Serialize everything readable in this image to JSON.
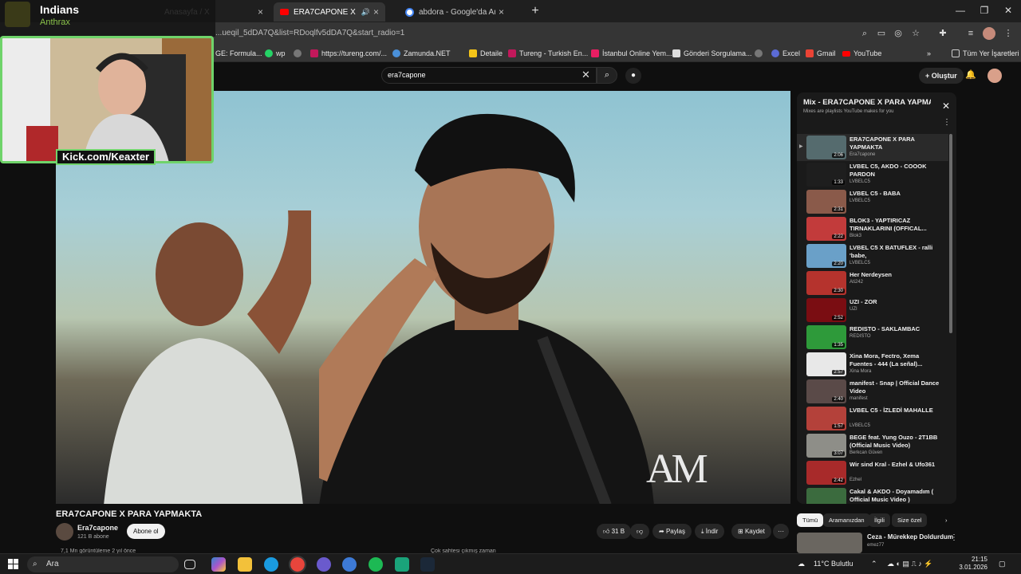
{
  "tabs": [
    {
      "title": "Anasayfa / X",
      "icon": "x-icon",
      "close": "×"
    },
    {
      "title": "ERA7CAPONE X PARA YAPM",
      "icon": "youtube-icon",
      "close": "×",
      "audio": "🔊"
    },
    {
      "title": "abdora - Google'da Ara",
      "icon": "google-icon",
      "close": "×"
    }
  ],
  "new_tab": "+",
  "window_controls": [
    "—",
    "❐",
    "✕"
  ],
  "address": {
    "url": "...ueqil_5dDA7Q&list=RDoqlfv5dDA7Q&start_radio=1"
  },
  "bookmarks": [
    {
      "label": "GE: Formula..."
    },
    {
      "label": "wp"
    },
    {
      "label": "https://tureng.com/..."
    },
    {
      "label": "Zamunda.NET"
    },
    {
      "label": "Detaile"
    },
    {
      "label": "Tureng - Turkish En..."
    },
    {
      "label": "İstanbul Online Yem..."
    },
    {
      "label": "Gönderi Sorgulama..."
    },
    {
      "label": "Excel"
    },
    {
      "label": "Gmail"
    },
    {
      "label": "YouTube"
    },
    {
      "label": "»"
    },
    {
      "label": "Tüm Yer İşaretleri"
    }
  ],
  "stream": {
    "channel": "Indians",
    "sub": "Anthrax",
    "kick_label": "Kick.com/Keaxter"
  },
  "youtube": {
    "search_value": "era7capone",
    "clear": "✕",
    "create_label": "+ Oluştur",
    "video_title": "ERA7CAPONE X PARA YAPMAKTA",
    "channel_name": "Era7capone",
    "subscribers": "121 B abone",
    "subscribe_label": "Abone ol",
    "likes": "31 B",
    "share_label": "Paylaş",
    "download_label": "İndir",
    "save_label": "Kaydet",
    "more": "···",
    "desc_left": "7,1 Mn görüntüleme  2 yıl önce",
    "desc_right": "Çok sahtesi çıkmış zaman"
  },
  "playlist": {
    "title": "Mix - ERA7CAPONE X PARA YAPMAKTA",
    "subtitle": "Mixes are playlists YouTube makes for you",
    "items": [
      {
        "title": "ERA7CAPONE X PARA YAPMAKTA",
        "channel": "Era7capone",
        "duration": "2:06",
        "color": "#556b6e"
      },
      {
        "title": "LVBEL C5, AKDO - COOOK PARDON",
        "channel": "LVBELC5",
        "duration": "1:33",
        "color": "#1e1e1e"
      },
      {
        "title": "LVBEL C5 - BABA",
        "channel": "LVBELC5",
        "duration": "2:31",
        "color": "#8a5a4a"
      },
      {
        "title": "BLOK3 - YAPTIRICAZ TIRNAKLARINI (OFFICAL...",
        "channel": "Blok3",
        "duration": "2:22",
        "color": "#c23b3b"
      },
      {
        "title": "LVBEL C5 X BATUFLEX - ralli 'babe,",
        "channel": "LVBELC5",
        "duration": "2:20",
        "color": "#6aa0c8"
      },
      {
        "title": "Her Nerdeysen",
        "channel": "Ati242",
        "duration": "2:30",
        "color": "#b5332d"
      },
      {
        "title": "UZI - ZOR",
        "channel": "UZI",
        "duration": "2:52",
        "color": "#7a0d12"
      },
      {
        "title": "REDISTO - SAKLAMBAC",
        "channel": "REDISTO",
        "duration": "1:35",
        "color": "#2e9a3a"
      },
      {
        "title": "Xina Mora, Fectro, Xema Fuentes - 444 (La señal)...",
        "channel": "Xina Mora",
        "duration": "2:57",
        "color": "#e8e8e8"
      },
      {
        "title": "manifest - Snap | Official Dance Video",
        "channel": "manifest",
        "duration": "2:40",
        "color": "#5a4a48"
      },
      {
        "title": "LVBEL C5 - İZLEDİ MAHALLE",
        "channel": "LVBELC5",
        "duration": "1:57",
        "color": "#b4413a"
      },
      {
        "title": "BEGE feat. Yung Ouzo - 2T1BB (Official Music Video)",
        "channel": "Berkcan Güven",
        "duration": "3:07",
        "color": "#8e8e88"
      },
      {
        "title": "Wir sind Kral - Ezhel & Ufo361",
        "channel": "Ezhel",
        "duration": "2:42",
        "color": "#a82a2a"
      },
      {
        "title": "Cakal & AKDO - Doyamadım ( Official Music Video )",
        "channel": "Cakal",
        "duration": "2:47",
        "color": "#3b6b3e"
      }
    ]
  },
  "chips": [
    "Tümü",
    "Aramanızdan",
    "İlgili",
    "Size özel",
    "›"
  ],
  "recommendation": {
    "title": "Ceza - Mürekkep Doldurdum",
    "channel": "emez77"
  },
  "taskbar": {
    "search_placeholder": "Ara",
    "weather": "11°C  Bulutlu",
    "time": "21:15",
    "date": "3.01.2026"
  }
}
